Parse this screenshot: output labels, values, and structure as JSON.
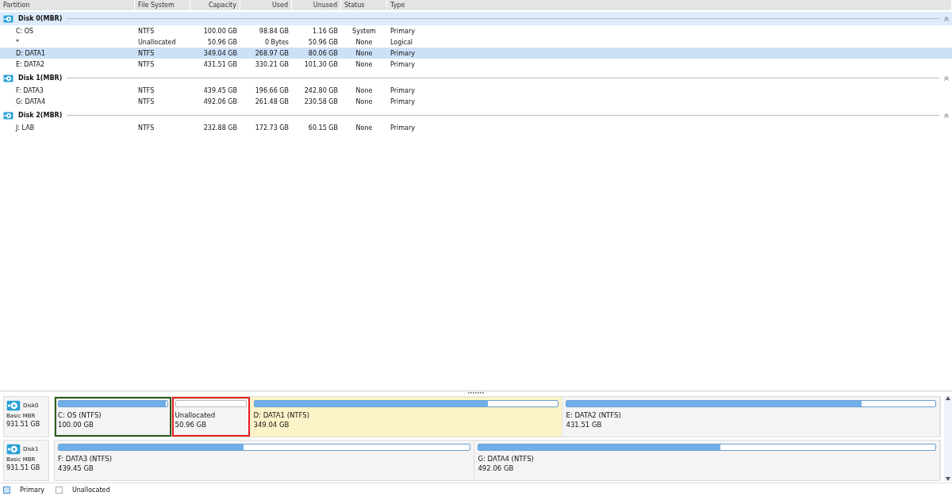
{
  "table": {
    "columns": [
      "Partition",
      "File System",
      "Capacity",
      "Used",
      "Unused",
      "Status",
      "Type"
    ],
    "disks": [
      {
        "name": "Disk 0(MBR)",
        "selected": true,
        "rows": [
          {
            "cells": [
              "C: OS",
              "NTFS",
              "100.00 GB",
              "98.84 GB",
              "1.16 GB",
              "System",
              "Primary"
            ],
            "selected": false
          },
          {
            "cells": [
              "*",
              "Unallocated",
              "50.96 GB",
              "0 Bytes",
              "50.96 GB",
              "None",
              "Logical"
            ],
            "selected": false
          },
          {
            "cells": [
              "D: DATA1",
              "NTFS",
              "349.04 GB",
              "268.97 GB",
              "80.06 GB",
              "None",
              "Primary"
            ],
            "selected": true
          },
          {
            "cells": [
              "E: DATA2",
              "NTFS",
              "431.51 GB",
              "330.21 GB",
              "101.30 GB",
              "None",
              "Primary"
            ],
            "selected": false
          }
        ]
      },
      {
        "name": "Disk 1(MBR)",
        "selected": false,
        "rows": [
          {
            "cells": [
              "F: DATA3",
              "NTFS",
              "439.45 GB",
              "196.66 GB",
              "242.80 GB",
              "None",
              "Primary"
            ],
            "selected": false
          },
          {
            "cells": [
              "G: DATA4",
              "NTFS",
              "492.06 GB",
              "261.48 GB",
              "230.58 GB",
              "None",
              "Primary"
            ],
            "selected": false
          }
        ]
      },
      {
        "name": "Disk 2(MBR)",
        "selected": false,
        "rows": [
          {
            "cells": [
              "J: LAB",
              "NTFS",
              "232.88 GB",
              "172.73 GB",
              "60.15 GB",
              "None",
              "Primary"
            ],
            "selected": false
          }
        ]
      }
    ]
  },
  "disk_map": [
    {
      "name": "Disk0",
      "type": "Basic MBR",
      "size": "931.51 GB",
      "partitions": [
        {
          "kind": "primary",
          "label": "C: OS (NTFS)",
          "size": "100.00 GB",
          "level": 0.99,
          "selected": false,
          "color": "#2e5c1e"
        },
        {
          "kind": "unallocated",
          "label": "Unallocated",
          "size": "50.96 GB",
          "selected": false,
          "color": "#e8201c"
        },
        {
          "kind": "primary",
          "label": "D: DATA1 (NTFS)",
          "size": "349.04 GB",
          "level": 0.77,
          "selected": true
        },
        {
          "kind": "primary",
          "label": "E: DATA2 (NTFS)",
          "size": "431.51 GB",
          "level": 0.8,
          "selected": false
        }
      ]
    },
    {
      "name": "Disk1",
      "type": "Basic MBR",
      "size": "931.51 GB",
      "partitions": [
        {
          "kind": "primary",
          "label": "F: DATA3 (NTFS)",
          "size": "439.45 GB",
          "level": 0.45,
          "selected": false
        },
        {
          "kind": "primary",
          "label": "G: DATA4 (NTFS)",
          "size": "492.06 GB",
          "level": 0.53,
          "selected": false
        }
      ]
    }
  ],
  "legend": [
    {
      "kind": "primary",
      "label": "Primary"
    },
    {
      "kind": "unallocated",
      "label": "Unallocated"
    }
  ]
}
